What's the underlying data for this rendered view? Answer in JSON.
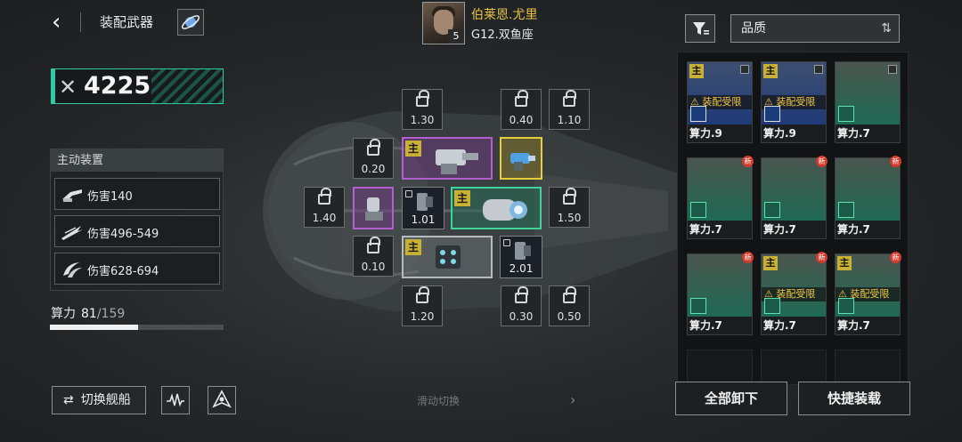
{
  "header": {
    "back_icon": "‹",
    "title": "装配武器"
  },
  "pilot": {
    "name": "伯莱恩.尤里",
    "level": "5",
    "ship": "G12.双鱼座"
  },
  "power": {
    "value": "4225"
  },
  "active_devices": {
    "title": "主动装置",
    "items": [
      {
        "label": "伤害140",
        "icon": "cannon-icon"
      },
      {
        "label": "伤害496-549",
        "icon": "missile-icon"
      },
      {
        "label": "伤害628-694",
        "icon": "claw-icon"
      }
    ]
  },
  "compute": {
    "label": "算力",
    "current": "81",
    "max": "/159",
    "fraction": 0.509
  },
  "bottom_left": {
    "switch_ship": "切换舰船",
    "swipe_hint": "滑动切换"
  },
  "slots": {
    "s1": "1.30",
    "s2": "0.40",
    "s3": "1.10",
    "s4": "0.20",
    "s5": "1.40",
    "s6": "1.01",
    "s7": "1.50",
    "s8": "0.10",
    "s9": "2.01",
    "s10": "1.20",
    "s11": "0.30",
    "s12": "0.50",
    "main_tag": "主"
  },
  "inventory": {
    "sort_label": "品质",
    "sort_icon": "⇅",
    "restrict_label": "装配受限",
    "cards": [
      {
        "cost": "算力.9"
      },
      {
        "cost": "算力.9"
      },
      {
        "cost": "算力.7"
      },
      {
        "cost": "算力.7"
      },
      {
        "cost": "算力.7"
      },
      {
        "cost": "算力.7"
      },
      {
        "cost": "算力.7"
      },
      {
        "cost": "算力.7"
      },
      {
        "cost": "算力.7"
      }
    ],
    "new_badge": "新",
    "unequip_all": "全部卸下",
    "quick_equip": "快捷装载"
  },
  "colors": {
    "accent": "#2fc9a4",
    "gold": "#e8c24a",
    "purple": "#b35fd2",
    "green": "#3fd49a"
  }
}
